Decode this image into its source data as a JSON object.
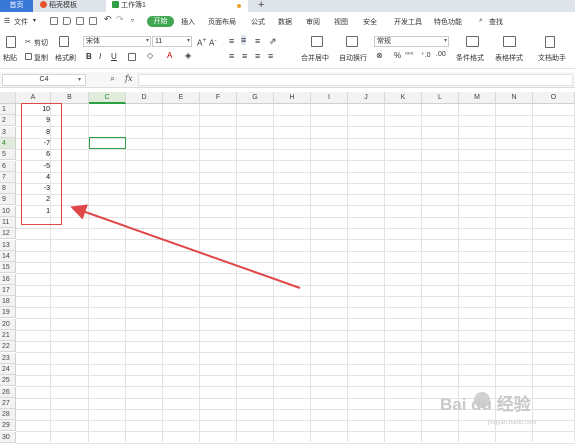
{
  "tabs": {
    "home": "首页",
    "template": "稻壳模板",
    "workbook": "工作簿1"
  },
  "menu": {
    "file": "文件",
    "start": "开始",
    "insert": "插入",
    "page_layout": "页面布局",
    "formula": "公式",
    "data": "数据",
    "review": "审阅",
    "view": "视图",
    "security": "安全",
    "developer": "开发工具",
    "special": "特色功能",
    "search": "查找"
  },
  "ribbon": {
    "paste": "粘贴",
    "cut": "剪切",
    "copy": "复制",
    "format_painter": "格式刷",
    "font_name": "宋体",
    "font_size": "11",
    "merge_center": "合并居中",
    "auto_wrap": "自动换行",
    "number_format": "常规",
    "conditional_format": "条件格式",
    "table_style": "表格样式",
    "doc_helper": "文档助手"
  },
  "formula_bar": {
    "name_box": "C4",
    "fx": "fx",
    "content": ""
  },
  "grid": {
    "columns": [
      "A",
      "B",
      "C",
      "D",
      "E",
      "F",
      "G",
      "H",
      "I",
      "J",
      "K",
      "L",
      "M",
      "N",
      "O"
    ],
    "selected_column": "C",
    "rows": [
      "1",
      "2",
      "3",
      "4",
      "5",
      "6",
      "7",
      "8",
      "9",
      "10",
      "11",
      "12",
      "13",
      "14",
      "15",
      "16",
      "17",
      "18",
      "19",
      "20",
      "21",
      "22",
      "23",
      "24",
      "25",
      "26",
      "27",
      "28",
      "29",
      "30"
    ],
    "selected_row": "4",
    "column_a_values": [
      "10",
      "9",
      "8",
      "-7",
      "6",
      "-5",
      "4",
      "-3",
      "2",
      "1"
    ]
  },
  "watermark": {
    "text": "Bai du 经验",
    "url": "jingyan.baidu.com"
  },
  "colors": {
    "accent_green": "#2f9e44",
    "highlight_red": "#e04848",
    "tab_blue": "#3a78d8"
  }
}
